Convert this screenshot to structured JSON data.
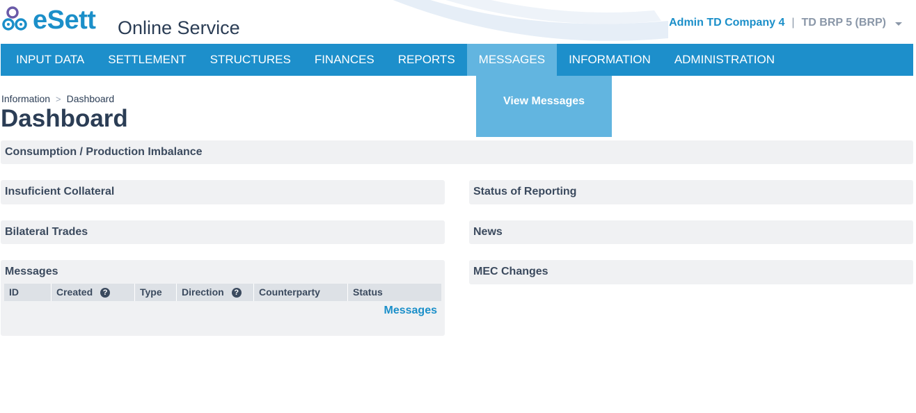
{
  "header": {
    "logo_text": "eSett",
    "service_title": "Online Service",
    "user_name": "Admin TD Company 4",
    "separator": "|",
    "user_role": "TD BRP 5 (BRP)",
    "icons": {
      "logo": "esett-logo-icon",
      "user_menu": "chevron-down-icon"
    }
  },
  "nav": {
    "items": [
      {
        "label": "INPUT DATA"
      },
      {
        "label": "SETTLEMENT"
      },
      {
        "label": "STRUCTURES"
      },
      {
        "label": "FINANCES"
      },
      {
        "label": "REPORTS"
      },
      {
        "label": "MESSAGES",
        "active": true
      },
      {
        "label": "INFORMATION"
      },
      {
        "label": "ADMINISTRATION"
      }
    ],
    "dropdown": {
      "items": [
        {
          "label": "View Messages"
        }
      ]
    }
  },
  "breadcrumb": {
    "items": [
      "Information",
      "Dashboard"
    ],
    "separator": ">"
  },
  "page_title": "Dashboard",
  "panels": {
    "imbalance": "Consumption / Production Imbalance",
    "collateral": "Insuficient Collateral",
    "reporting": "Status of Reporting",
    "bilateral": "Bilateral Trades",
    "news": "News",
    "messages": {
      "title": "Messages",
      "columns": [
        {
          "label": "ID",
          "help": false
        },
        {
          "label": "Created",
          "help": true
        },
        {
          "label": "Type",
          "help": false
        },
        {
          "label": "Direction",
          "help": true
        },
        {
          "label": "Counterparty",
          "help": false
        },
        {
          "label": "Status",
          "help": false
        }
      ],
      "help_glyph": "?",
      "link": "Messages"
    },
    "mec": "MEC Changes"
  },
  "colors": {
    "brand_blue": "#1d8fcb",
    "nav_active": "#62b5e0",
    "title_text": "#2b3d55",
    "panel_bg": "#f0f1f3"
  }
}
